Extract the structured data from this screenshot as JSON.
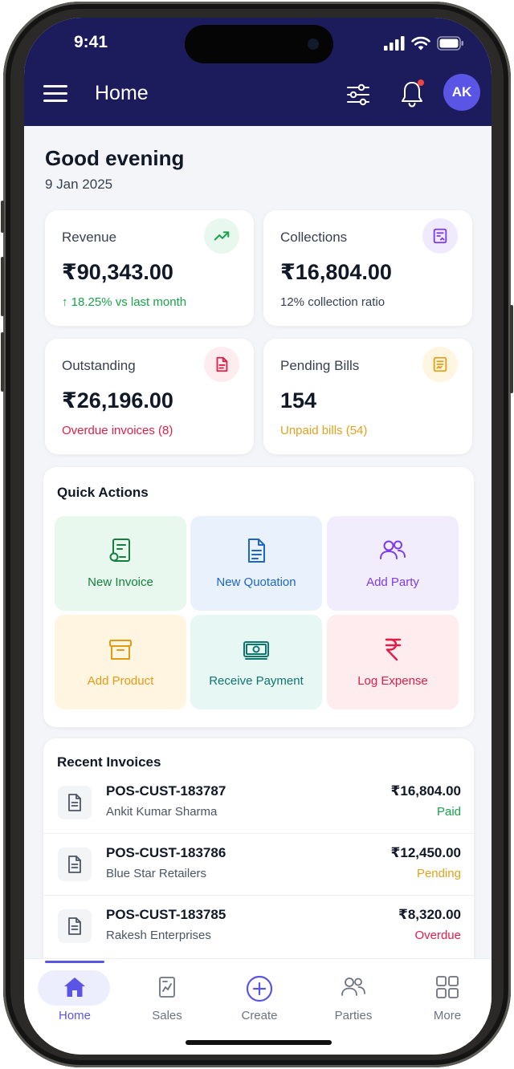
{
  "status_bar": {
    "time": "9:41"
  },
  "header": {
    "title": "Home",
    "avatar_initials": "AK"
  },
  "greeting": {
    "text": "Good evening",
    "date": "9 Jan 2025"
  },
  "stats": [
    {
      "label": "Revenue",
      "value": "₹90,343.00",
      "sub": "↑ 18.25% vs last month",
      "sub_color": "#16a34a",
      "icon": "trending-up-icon",
      "icon_color": "#16a34a",
      "icon_bg": "#e8f8ee"
    },
    {
      "label": "Collections",
      "value": "₹16,804.00",
      "sub": "12% collection ratio",
      "sub_color": "#374151",
      "icon": "receipt-icon",
      "icon_color": "#7c3aed",
      "icon_bg": "#efeafe"
    },
    {
      "label": "Outstanding",
      "value": "₹26,196.00",
      "sub": "Overdue invoices (8)",
      "sub_color": "#e11d48",
      "icon": "document-alert-icon",
      "icon_color": "#e11d48",
      "icon_bg": "#feecef"
    },
    {
      "label": "Pending Bills",
      "value": "154",
      "sub": "Unpaid bills (54)",
      "sub_color": "#e0a21a",
      "icon": "bill-icon",
      "icon_color": "#e0a21a",
      "icon_bg": "#fff6e2"
    }
  ],
  "quick_actions": {
    "title": "Quick Actions",
    "items": [
      {
        "label": "New Invoice",
        "icon": "invoice-icon",
        "color": "#15803d",
        "bg": "#e8f8ef"
      },
      {
        "label": "New Quotation",
        "icon": "document-icon",
        "color": "#1d66c9",
        "bg": "#e9f1fd"
      },
      {
        "label": "Add Party",
        "icon": "users-icon",
        "color": "#7c3aed",
        "bg": "#f2edfd"
      },
      {
        "label": "Add Product",
        "icon": "archive-box-icon",
        "color": "#e59a14",
        "bg": "#fff5e1"
      },
      {
        "label": "Receive Payment",
        "icon": "banknote-icon",
        "color": "#0f766e",
        "bg": "#e7f7f4"
      },
      {
        "label": "Log Expense",
        "icon": "rupee-icon",
        "color": "#e11d48",
        "bg": "#feecef"
      }
    ]
  },
  "recent_invoices": {
    "title": "Recent Invoices",
    "items": [
      {
        "number": "POS-CUST-183787",
        "party": "Ankit Kumar Sharma",
        "amount": "₹16,804.00",
        "status": "Paid",
        "status_color": "#16a34a"
      },
      {
        "number": "POS-CUST-183786",
        "party": "Blue Star Retailers",
        "amount": "₹12,450.00",
        "status": "Pending",
        "status_color": "#e0a21a"
      },
      {
        "number": "POS-CUST-183785",
        "party": "Rakesh Enterprises",
        "amount": "₹8,320.00",
        "status": "Overdue",
        "status_color": "#e11d48"
      }
    ]
  },
  "bottom_nav": {
    "active": "Home",
    "items": [
      {
        "label": "Home",
        "icon": "home-icon"
      },
      {
        "label": "Sales",
        "icon": "sales-receipt-icon"
      },
      {
        "label": "Create",
        "icon": "plus-circle-icon"
      },
      {
        "label": "Parties",
        "icon": "users-icon"
      },
      {
        "label": "More",
        "icon": "grid-icon"
      }
    ]
  },
  "theme": {
    "header_bg": "#1c1b5b",
    "accent": "#5b55e6"
  }
}
